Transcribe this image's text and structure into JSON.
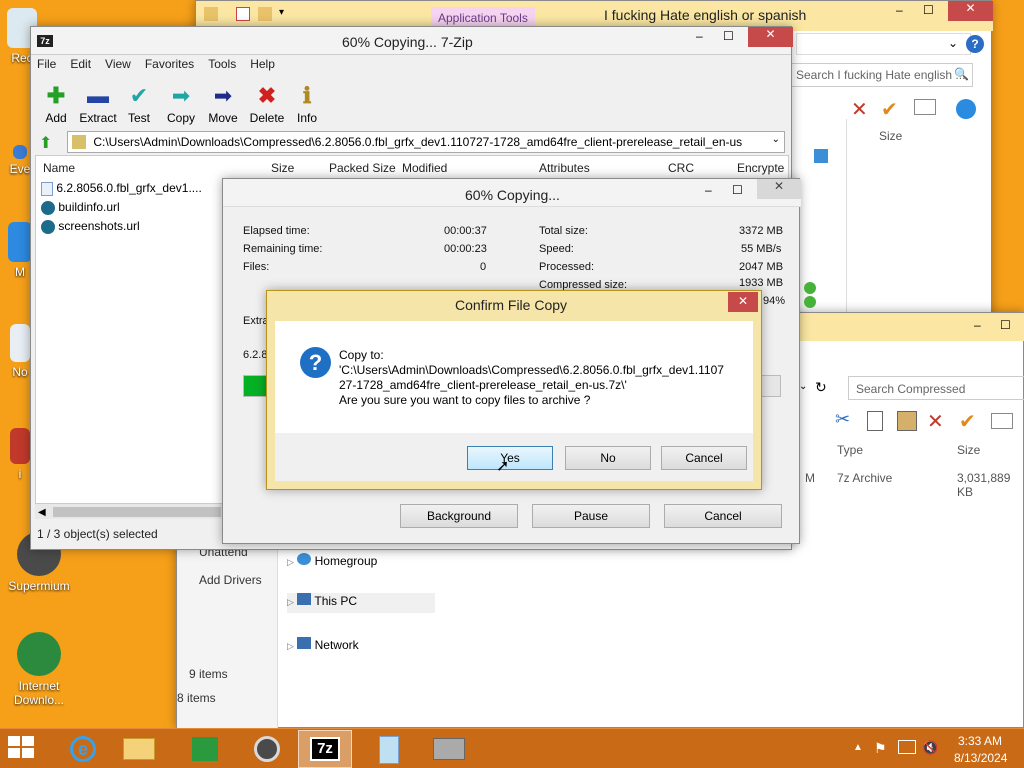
{
  "desktop": {
    "icons": [
      {
        "label": "Rec"
      },
      {
        "label": "Eve"
      },
      {
        "label": "M"
      },
      {
        "label": "No"
      },
      {
        "label": "i"
      },
      {
        "label": "Supermium"
      },
      {
        "label": "Internet Downlo..."
      }
    ]
  },
  "explorer_back": {
    "title": "I fucking Hate english or spanish",
    "ribbon_tab": "Application Tools",
    "search_placeholder": "Search I fucking Hate english ...",
    "col_size": "Size"
  },
  "explorer_front": {
    "search_placeholder": "Search Compressed",
    "col_type": "Type",
    "col_size": "Size",
    "row_type_partial": "M",
    "row_type": "7z Archive",
    "row_size": "3,031,889 KB",
    "nav_items": [
      "Homegroup",
      "This PC",
      "Network"
    ],
    "left_items": [
      "Unattend",
      "Add Drivers"
    ],
    "status_items_inner": "9 items",
    "status_items_outer": "8 items"
  },
  "sevenzip": {
    "title": "60% Copying... 7-Zip",
    "menu": [
      "File",
      "Edit",
      "View",
      "Favorites",
      "Tools",
      "Help"
    ],
    "toolbar": [
      "Add",
      "Extract",
      "Test",
      "Copy",
      "Move",
      "Delete",
      "Info"
    ],
    "path": "C:\\Users\\Admin\\Downloads\\Compressed\\6.2.8056.0.fbl_grfx_dev1.110727-1728_amd64fre_client-prerelease_retail_en-us.7z\\",
    "columns": [
      "Name",
      "Size",
      "Packed Size",
      "Modified",
      "Attributes",
      "CRC",
      "Encrypte"
    ],
    "files": [
      "6.2.8056.0.fbl_grfx_dev1....",
      "buildinfo.url",
      "screenshots.url"
    ],
    "status": "1 / 3 object(s) selected"
  },
  "progress": {
    "title": "60% Copying...",
    "elapsed_label": "Elapsed time:",
    "elapsed": "00:00:37",
    "remaining_label": "Remaining time:",
    "remaining": "00:00:23",
    "files_label": "Files:",
    "files": "0",
    "total_label": "Total size:",
    "total": "3372 MB",
    "speed_label": "Speed:",
    "speed": "55 MB/s",
    "processed_label": "Processed:",
    "processed": "2047 MB",
    "compressed_label": "Compressed size:",
    "compressed": "1933 MB",
    "ratio": "94%",
    "extract_partial": "Extra",
    "file_partial": "6.2.8",
    "percent": 60,
    "background_btn": "Background",
    "pause_btn": "Pause",
    "cancel_btn": "Cancel"
  },
  "confirm": {
    "title": "Confirm File Copy",
    "line1": "Copy to:",
    "line2": "'C:\\Users\\Admin\\Downloads\\Compressed\\6.2.8056.0.fbl_grfx_dev1.1107",
    "line3": "27-1728_amd64fre_client-prerelease_retail_en-us.7z\\'",
    "line4": "Are you sure you want to copy files to archive ?",
    "yes": "Yes",
    "no": "No",
    "cancel": "Cancel"
  },
  "taskbar": {
    "time": "3:33 AM",
    "date": "8/13/2024",
    "app_label": "7z"
  },
  "colors": {
    "desktop": "#f6a01a",
    "taskbar": "#c96a16",
    "accent": "#f6e5a8"
  }
}
